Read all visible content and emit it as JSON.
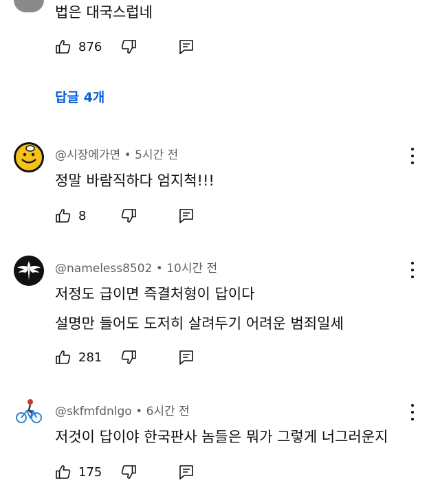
{
  "top_comment": {
    "text": "법은 대국스럽네",
    "likes": "876",
    "replies_label": "답글 4개"
  },
  "replies": [
    {
      "handle": "@시장에가면",
      "time": "5시간 전",
      "lines": [
        "정말 바람직하다 엄지척!!!"
      ],
      "likes": "8"
    },
    {
      "handle": "@nameless8502",
      "time": "10시간 전",
      "lines": [
        "저정도 급이면 즉결처형이 답이다",
        "설명만 들어도 도저히 살려두기 어려운 범죄일세"
      ],
      "likes": "281"
    },
    {
      "handle": "@skfmfdnlgo",
      "time": "6시간 전",
      "lines": [
        "저것이 답이야 한국판사 놈들은 뭐가 그렇게 너그러운지"
      ],
      "likes": "175"
    }
  ],
  "separator": "•",
  "icons": {
    "like": "thumbs-up-icon",
    "dislike": "thumbs-down-icon",
    "reply": "reply-icon",
    "more": "more-vert-icon"
  },
  "colors": {
    "link": "#065fd4",
    "meta": "#606060"
  }
}
